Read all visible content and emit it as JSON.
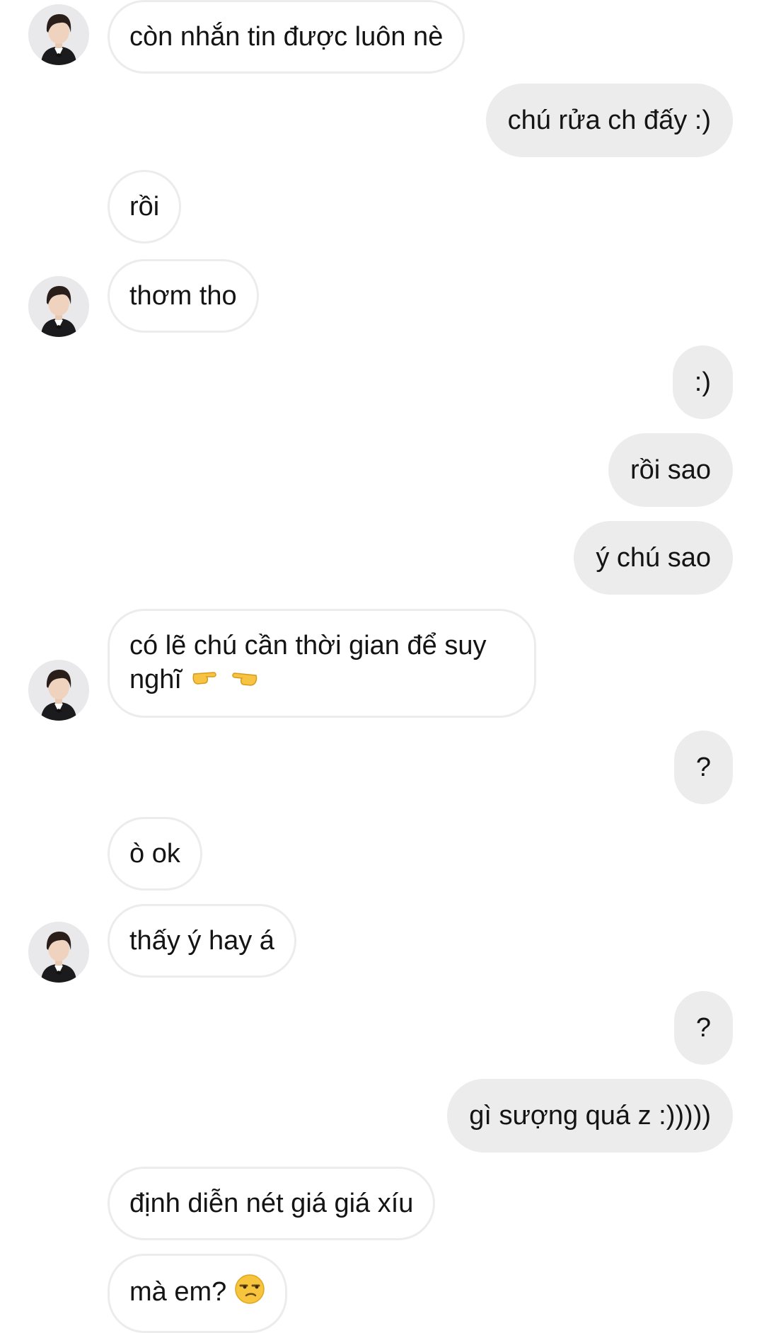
{
  "messages": [
    {
      "side": "received",
      "text": "còn nhắn tin được luôn nè",
      "has_avatar": true
    },
    {
      "side": "sent",
      "text": "chú rửa ch đấy :)"
    },
    {
      "side": "received",
      "text": "rồi"
    },
    {
      "side": "received",
      "text": "thơm tho",
      "has_avatar": true
    },
    {
      "side": "sent",
      "text": ":)"
    },
    {
      "side": "sent",
      "text": "rồi sao"
    },
    {
      "side": "sent",
      "text": "ý chú sao"
    },
    {
      "side": "received",
      "text_line1": "có lẽ chú cần thời gian để suy",
      "text_line2": "nghĩ",
      "emoji": "pointing-hands-emoji",
      "has_avatar": true
    },
    {
      "side": "sent",
      "text": "?"
    },
    {
      "side": "received",
      "text": "ò ok"
    },
    {
      "side": "received",
      "text": "thấy ý hay á",
      "has_avatar": true
    },
    {
      "side": "sent",
      "text": "?"
    },
    {
      "side": "sent",
      "text": "gì sượng quá z :)))))"
    },
    {
      "side": "received",
      "text": "định diễn nét giá giá xíu"
    },
    {
      "side": "received",
      "text": "mà em?",
      "emoji": "unamused-face-emoji"
    }
  ],
  "colors": {
    "sent_bubble": "#ececec",
    "received_border": "#ececec",
    "text": "#141414"
  }
}
